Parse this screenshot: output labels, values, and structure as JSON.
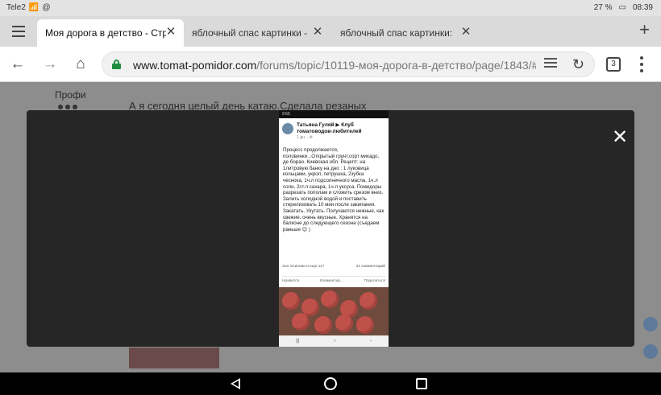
{
  "status_bar": {
    "carrier": "Tele2",
    "battery": "27 %",
    "time": "08:39"
  },
  "tabs": [
    {
      "title": "Моя дорога в детство - Стр",
      "active": true
    },
    {
      "title": "яблочный спас картинки -",
      "active": false
    },
    {
      "title": "яблочный спас картинки: ",
      "active": false
    }
  ],
  "tab_close_glyph": "✕",
  "toolbar": {
    "url_host": "www.tomat-pomidor.com",
    "url_path": "/forums/topic/10119-моя-дорога-в-детство/page/1843/#co",
    "tab_count": "3"
  },
  "page": {
    "sidebar_label": "Профи",
    "text": "А я сегодня  целый день катаю.Сделала резаных"
  },
  "lightbox": {
    "close_glyph": "✕",
    "phone": {
      "status_time": "9:55",
      "author": "Татьяна Гуляй ▶ Клуб томатоводов-любителей",
      "meta": "1 дн. · ⚙",
      "body": "Процесс продолжается, половинки...Открытый грунт,сорт микадо, де борао. Киевская обл. Рецепт: на 1литровую банку на дно : 1 луковица кольцами, укроп, петрушка, 2зубка чеснока, 1ч.л подсолнечного масла, 1ч.л соли, 2ст.л сахара, 1ч.л уксуса. Помидоры разрезать пополам и сложить срезом вниз. Залить холодной водой и поставить стерелизовать 10 мин после закипания. Закатать. Укутать. Получаются нежные, как свежие, очень вкусные. Хранятся на балконе до следующего сезона (съедаем раньше 😉 )",
      "reactions": "Зоя Осипова и еще 117",
      "comments": "21 комментарий",
      "actions": [
        "Нравится",
        "Комментир...",
        "Поделиться"
      ]
    }
  }
}
